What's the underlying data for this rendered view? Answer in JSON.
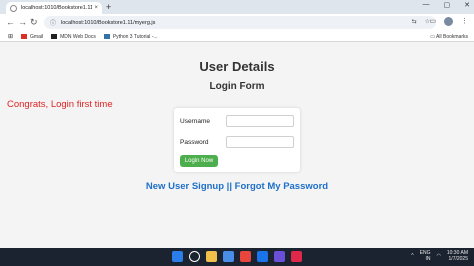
{
  "browser": {
    "tab_title": "localhost:1010/Bookstore1.11/",
    "tab_close": "×",
    "new_tab": "+",
    "window_controls": [
      "—",
      "▢",
      "✕"
    ],
    "url": "localhost:1010/Bookstore1.11/myerg.js",
    "bookmarks": [
      {
        "label": "Gmail",
        "icon": "gmail-icon",
        "color": "#d93025"
      },
      {
        "label": "MDN Web Docs",
        "icon": "mdn-icon",
        "color": "#222222"
      },
      {
        "label": "Python 3 Tutorial -...",
        "icon": "python-icon",
        "color": "#3572a5"
      }
    ],
    "all_bookmarks": "All Bookmarks"
  },
  "page": {
    "heading": "User Details",
    "subheading": "Login Form",
    "message": "Congrats, Login first time",
    "form": {
      "username_label": "Username",
      "username_value": "",
      "password_label": "Password",
      "password_value": "",
      "submit_label": "Login Now"
    },
    "links": {
      "signup": "New User Signup",
      "separator": " || ",
      "forgot": "Forgot My Password"
    }
  },
  "taskbar": {
    "lang_line1": "ENG",
    "lang_line2": "IN",
    "time": "10:30 AM",
    "date": "1/7/2025",
    "app_colors": [
      "#2b7de9",
      "#ffffff",
      "#f0c04a",
      "#4a8fe7",
      "#e8453c",
      "#1a73e8",
      "#6a4fd8",
      "#e0284b"
    ]
  },
  "colors": {
    "message_red": "#e02424",
    "link_blue": "#1d6fc9",
    "button_green": "#4cae4c"
  }
}
